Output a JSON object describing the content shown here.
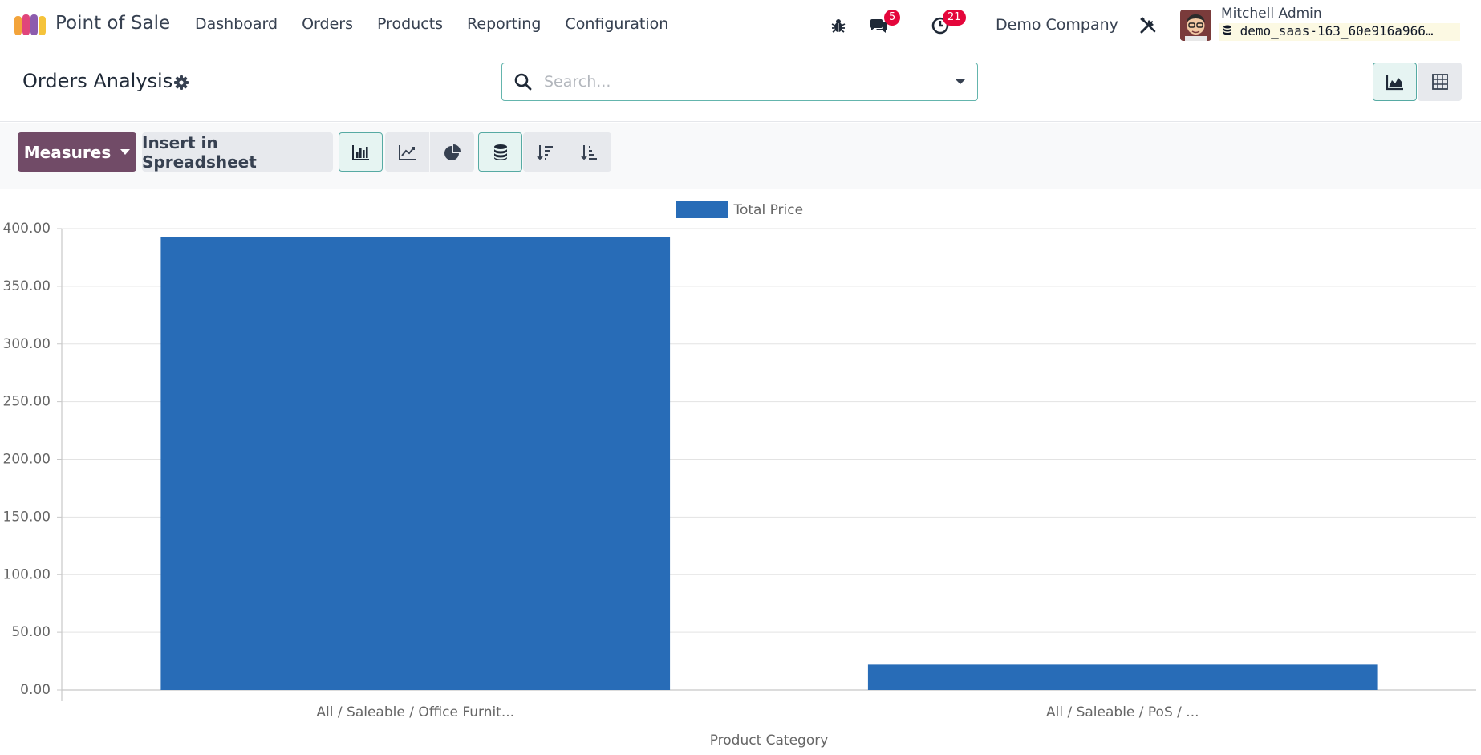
{
  "app": {
    "name": "Point of Sale",
    "menu": [
      "Dashboard",
      "Orders",
      "Products",
      "Reporting",
      "Configuration"
    ]
  },
  "systray": {
    "messages_badge": "5",
    "activities_badge": "21",
    "company": "Demo Company",
    "user_name": "Mitchell Admin",
    "database": "demo_saas-163_60e916a966…"
  },
  "control": {
    "title": "Orders Analysis",
    "search_placeholder": "Search..."
  },
  "toolbar": {
    "measures_label": "Measures",
    "insert_label": "Insert in Spreadsheet"
  },
  "colors": {
    "brand": "#714b67",
    "bar": "#286cb7",
    "accent": "#56aaa3",
    "badge": "#e4063b"
  },
  "chart_data": {
    "type": "bar",
    "categories": [
      "All / Saleable / Office Furnit...",
      "All / Saleable / PoS / ..."
    ],
    "series": [
      {
        "name": "Total Price",
        "values": [
          393,
          22
        ]
      }
    ],
    "xlabel": "Product Category",
    "ylabel": "",
    "ylim": [
      0,
      400
    ],
    "yticks": [
      "0.00",
      "50.00",
      "100.00",
      "150.00",
      "200.00",
      "250.00",
      "300.00",
      "350.00",
      "400.00"
    ],
    "legend": "top-center",
    "grid": true
  }
}
